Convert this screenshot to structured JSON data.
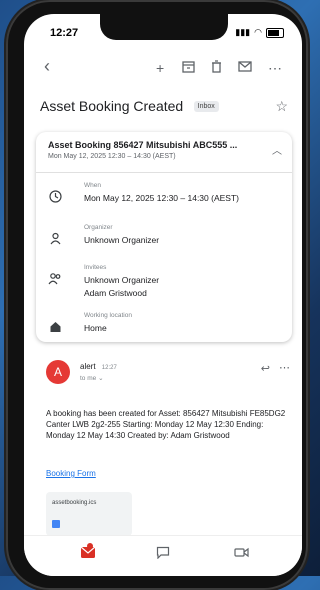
{
  "status_bar": {
    "time": "12:27"
  },
  "toolbar": {
    "back": "‹",
    "add": "+",
    "more": "⋯"
  },
  "email": {
    "subject": "Asset Booking Created",
    "label_chip": "Inbox"
  },
  "event_card": {
    "title": "Asset Booking 856427 Mitsubishi ABC555 ...",
    "subtitle": "Mon May 12, 2025 12:30 – 14:30 (AEST)",
    "when_label": "When",
    "when_value": "Mon May 12, 2025 12:30 – 14:30 (AEST)",
    "organizer_label": "Organizer",
    "organizer_value": "Unknown Organizer",
    "invitees_label": "Invitees",
    "invitees": [
      "Unknown Organizer",
      "Adam Gristwood"
    ],
    "location_label": "Working location",
    "location_value": "Home"
  },
  "message": {
    "avatar_letter": "A",
    "sender": "alert",
    "time": "12:27",
    "to": "to me",
    "body": "A booking has been created for Asset: 856427 Mitsubishi FE85DG2 Canter LWB 2g2-255 Starting: Monday 12 May 12:30 Ending: Monday 12 May 14:30 Created by: Adam Gristwood",
    "link": "Booking Form",
    "attachment": "assetbooking.ics"
  }
}
